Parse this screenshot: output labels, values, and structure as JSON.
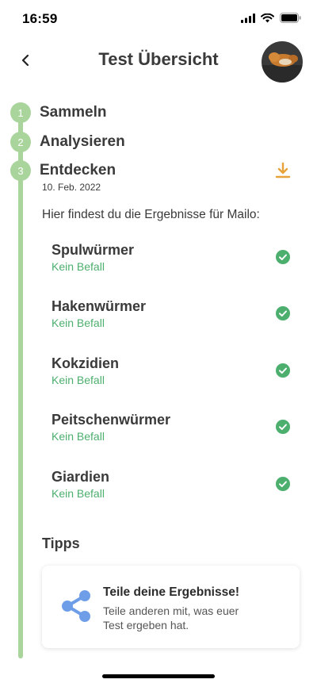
{
  "status_bar": {
    "time": "16:59"
  },
  "header": {
    "title": "Test Übersicht"
  },
  "steps": [
    {
      "number": "1",
      "label": "Sammeln"
    },
    {
      "number": "2",
      "label": "Analysieren"
    },
    {
      "number": "3",
      "label": "Entdecken",
      "date": "10. Feb. 2022"
    }
  ],
  "results": {
    "intro": "Hier findest du die Ergebnisse für Mailo:",
    "items": [
      {
        "name": "Spulwürmer",
        "status": "Kein Befall"
      },
      {
        "name": "Hakenwürmer",
        "status": "Kein Befall"
      },
      {
        "name": "Kokzidien",
        "status": "Kein Befall"
      },
      {
        "name": "Peitschenwürmer",
        "status": "Kein Befall"
      },
      {
        "name": "Giardien",
        "status": "Kein Befall"
      }
    ]
  },
  "tips": {
    "heading": "Tipps",
    "card": {
      "title": "Teile deine Ergebnisse!",
      "text": "Teile anderen mit, was euer Test ergeben hat."
    }
  },
  "colors": {
    "accent_green": "#a9d59d",
    "status_green": "#4caf6e",
    "download_orange": "#e8a23a",
    "share_blue": "#6f9ee8"
  },
  "icons": {
    "back": "chevron-left-icon",
    "download": "download-icon",
    "check": "check-circle-icon",
    "share": "share-icon"
  }
}
